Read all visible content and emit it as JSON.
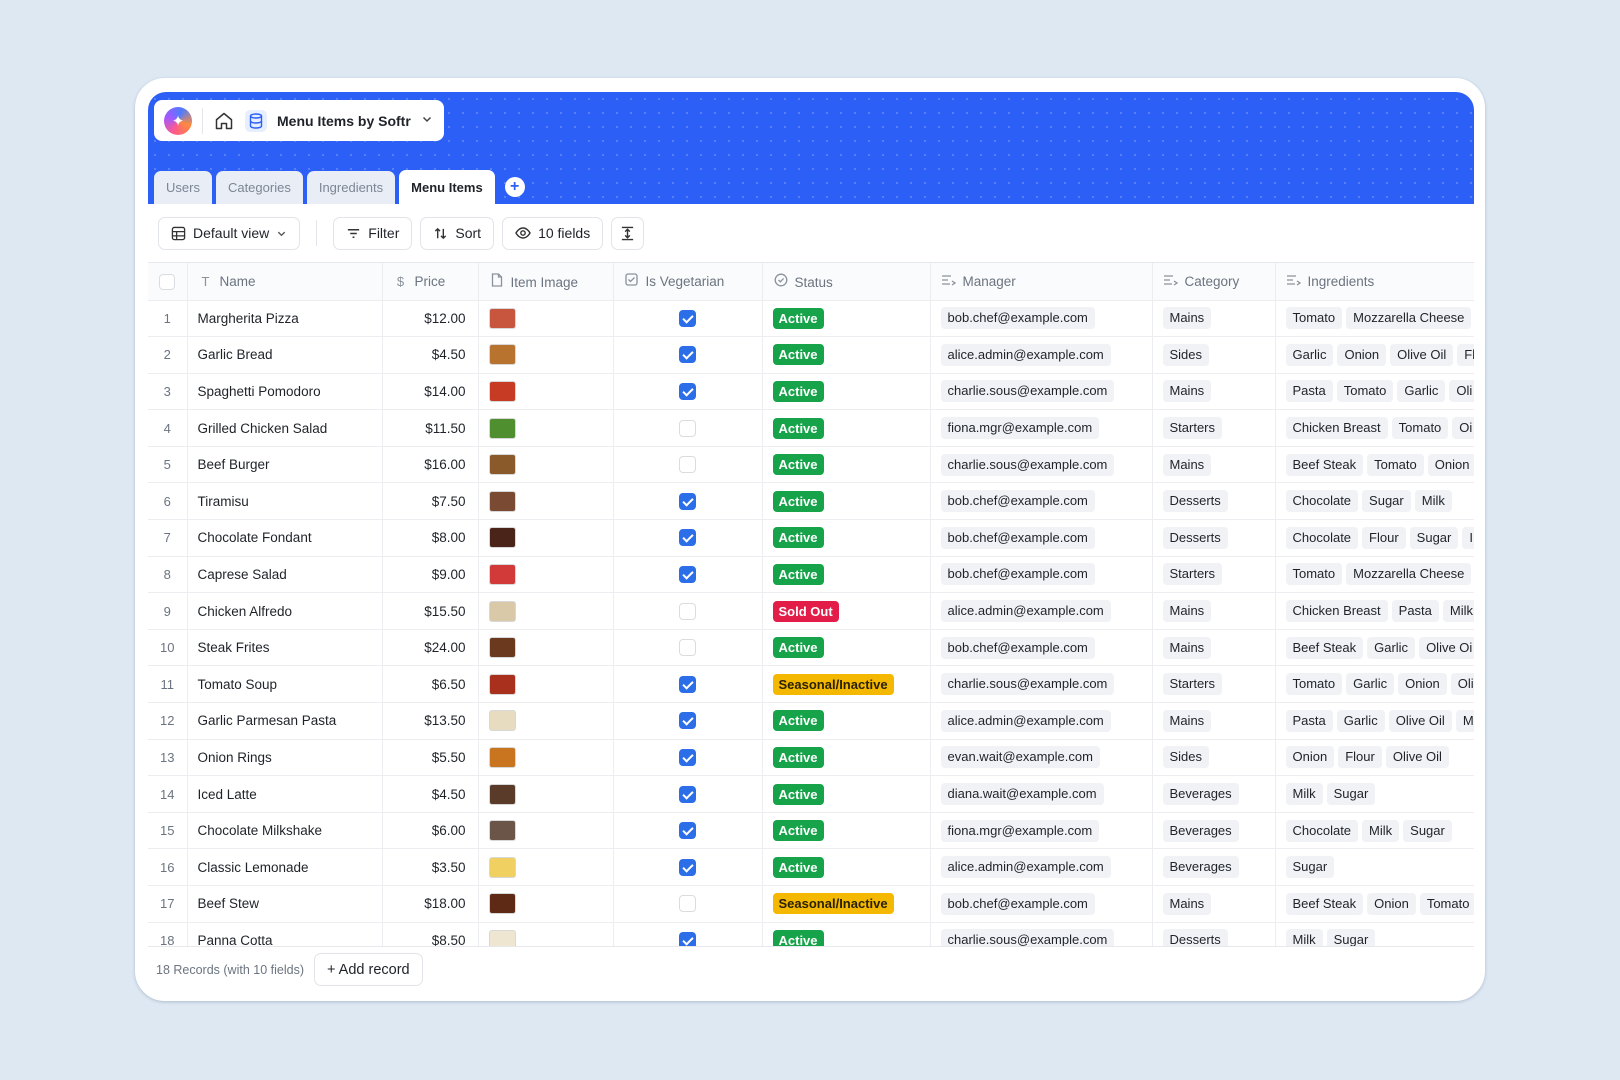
{
  "header": {
    "app_name": "Menu Items by Softr",
    "tabs": [
      {
        "label": "Users",
        "active": false
      },
      {
        "label": "Categories",
        "active": false
      },
      {
        "label": "Ingredients",
        "active": false
      },
      {
        "label": "Menu Items",
        "active": true
      }
    ],
    "add_tab_label": "+"
  },
  "toolbar": {
    "view_label": "Default view",
    "filter_label": "Filter",
    "sort_label": "Sort",
    "fields_label": "10 fields"
  },
  "columns": [
    {
      "label": "Name",
      "icon": "text-type-icon"
    },
    {
      "label": "Price",
      "icon": "dollar-icon"
    },
    {
      "label": "Item Image",
      "icon": "file-icon"
    },
    {
      "label": "Is Vegetarian",
      "icon": "checkbox-icon"
    },
    {
      "label": "Status",
      "icon": "status-circle-icon"
    },
    {
      "label": "Manager",
      "icon": "link-list-icon"
    },
    {
      "label": "Category",
      "icon": "link-list-icon"
    },
    {
      "label": "Ingredients",
      "icon": "link-list-icon"
    }
  ],
  "status_colors": {
    "Active": "#16a34a",
    "Sold Out": "#e11d48",
    "Seasonal/Inactive": "#f5b800"
  },
  "rows": [
    {
      "id": "1",
      "name": "Margherita Pizza",
      "price": "$12.00",
      "thumb": "#c8553d",
      "veg": true,
      "status": "Active",
      "manager": "bob.chef@example.com",
      "category": "Mains",
      "ingredients": [
        "Tomato",
        "Mozzarella Cheese"
      ]
    },
    {
      "id": "2",
      "name": "Garlic Bread",
      "price": "$4.50",
      "thumb": "#b8732e",
      "veg": true,
      "status": "Active",
      "manager": "alice.admin@example.com",
      "category": "Sides",
      "ingredients": [
        "Garlic",
        "Onion",
        "Olive Oil",
        "Fl"
      ]
    },
    {
      "id": "3",
      "name": "Spaghetti Pomodoro",
      "price": "$14.00",
      "thumb": "#c73a24",
      "veg": true,
      "status": "Active",
      "manager": "charlie.sous@example.com",
      "category": "Mains",
      "ingredients": [
        "Pasta",
        "Tomato",
        "Garlic",
        "Oli"
      ]
    },
    {
      "id": "4",
      "name": "Grilled Chicken Salad",
      "price": "$11.50",
      "thumb": "#4f8f2f",
      "veg": false,
      "status": "Active",
      "manager": "fiona.mgr@example.com",
      "category": "Starters",
      "ingredients": [
        "Chicken Breast",
        "Tomato",
        "Oi"
      ]
    },
    {
      "id": "5",
      "name": "Beef Burger",
      "price": "$16.00",
      "thumb": "#8a5a2b",
      "veg": false,
      "status": "Active",
      "manager": "charlie.sous@example.com",
      "category": "Mains",
      "ingredients": [
        "Beef Steak",
        "Tomato",
        "Onion"
      ]
    },
    {
      "id": "6",
      "name": "Tiramisu",
      "price": "$7.50",
      "thumb": "#7a4a32",
      "veg": true,
      "status": "Active",
      "manager": "bob.chef@example.com",
      "category": "Desserts",
      "ingredients": [
        "Chocolate",
        "Sugar",
        "Milk"
      ]
    },
    {
      "id": "7",
      "name": "Chocolate Fondant",
      "price": "$8.00",
      "thumb": "#4a2418",
      "veg": true,
      "status": "Active",
      "manager": "bob.chef@example.com",
      "category": "Desserts",
      "ingredients": [
        "Chocolate",
        "Flour",
        "Sugar",
        "I"
      ]
    },
    {
      "id": "8",
      "name": "Caprese Salad",
      "price": "$9.00",
      "thumb": "#d23a3a",
      "veg": true,
      "status": "Active",
      "manager": "bob.chef@example.com",
      "category": "Starters",
      "ingredients": [
        "Tomato",
        "Mozzarella Cheese"
      ]
    },
    {
      "id": "9",
      "name": "Chicken Alfredo",
      "price": "$15.50",
      "thumb": "#d9c9a8",
      "veg": false,
      "status": "Sold Out",
      "manager": "alice.admin@example.com",
      "category": "Mains",
      "ingredients": [
        "Chicken Breast",
        "Pasta",
        "Milk"
      ]
    },
    {
      "id": "10",
      "name": "Steak Frites",
      "price": "$24.00",
      "thumb": "#6b3a1e",
      "veg": false,
      "status": "Active",
      "manager": "bob.chef@example.com",
      "category": "Mains",
      "ingredients": [
        "Beef Steak",
        "Garlic",
        "Olive Oi"
      ]
    },
    {
      "id": "11",
      "name": "Tomato Soup",
      "price": "$6.50",
      "thumb": "#a8301c",
      "veg": true,
      "status": "Seasonal/Inactive",
      "manager": "charlie.sous@example.com",
      "category": "Starters",
      "ingredients": [
        "Tomato",
        "Garlic",
        "Onion",
        "Oli"
      ]
    },
    {
      "id": "12",
      "name": "Garlic Parmesan Pasta",
      "price": "$13.50",
      "thumb": "#e8dcc0",
      "veg": true,
      "status": "Active",
      "manager": "alice.admin@example.com",
      "category": "Mains",
      "ingredients": [
        "Pasta",
        "Garlic",
        "Olive Oil",
        "M"
      ]
    },
    {
      "id": "13",
      "name": "Onion Rings",
      "price": "$5.50",
      "thumb": "#c9741f",
      "veg": true,
      "status": "Active",
      "manager": "evan.wait@example.com",
      "category": "Sides",
      "ingredients": [
        "Onion",
        "Flour",
        "Olive Oil"
      ]
    },
    {
      "id": "14",
      "name": "Iced Latte",
      "price": "$4.50",
      "thumb": "#5a3a28",
      "veg": true,
      "status": "Active",
      "manager": "diana.wait@example.com",
      "category": "Beverages",
      "ingredients": [
        "Milk",
        "Sugar"
      ]
    },
    {
      "id": "15",
      "name": "Chocolate Milkshake",
      "price": "$6.00",
      "thumb": "#6a5548",
      "veg": true,
      "status": "Active",
      "manager": "fiona.mgr@example.com",
      "category": "Beverages",
      "ingredients": [
        "Chocolate",
        "Milk",
        "Sugar"
      ]
    },
    {
      "id": "16",
      "name": "Classic Lemonade",
      "price": "$3.50",
      "thumb": "#f0d060",
      "veg": true,
      "status": "Active",
      "manager": "alice.admin@example.com",
      "category": "Beverages",
      "ingredients": [
        "Sugar"
      ]
    },
    {
      "id": "17",
      "name": "Beef Stew",
      "price": "$18.00",
      "thumb": "#5e2a16",
      "veg": false,
      "status": "Seasonal/Inactive",
      "manager": "bob.chef@example.com",
      "category": "Mains",
      "ingredients": [
        "Beef Steak",
        "Onion",
        "Tomato"
      ]
    },
    {
      "id": "18",
      "name": "Panna Cotta",
      "price": "$8.50",
      "thumb": "#efe6d2",
      "veg": true,
      "status": "Active",
      "manager": "charlie.sous@example.com",
      "category": "Desserts",
      "ingredients": [
        "Milk",
        "Sugar"
      ]
    }
  ],
  "footer": {
    "record_count": "18 Records (with 10 fields)",
    "add_record_label": "+ Add record"
  }
}
